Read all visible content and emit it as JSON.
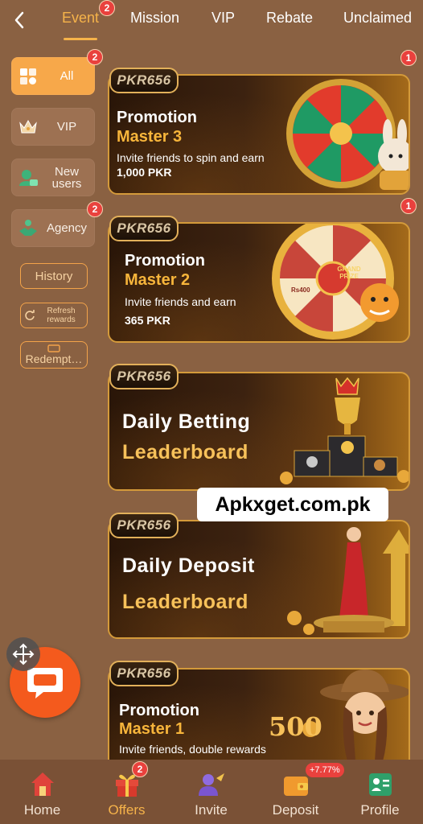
{
  "tabs": [
    {
      "label": "Event",
      "active": true,
      "badge": "2"
    },
    {
      "label": "Mission"
    },
    {
      "label": "VIP"
    },
    {
      "label": "Rebate"
    },
    {
      "label": "Unclaimed"
    }
  ],
  "sidebar": {
    "items": [
      {
        "label": "All",
        "icon": "grid-icon",
        "active": true,
        "badge": "2"
      },
      {
        "label": "VIP",
        "icon": "crown-icon"
      },
      {
        "label": "New users",
        "icon": "new-user-icon"
      },
      {
        "label": "Agency",
        "icon": "handshake-icon",
        "badge": "2"
      }
    ],
    "history_label": "History",
    "refresh_label": "Refresh rewards",
    "redeem_label": "Redempt…"
  },
  "banners": [
    {
      "logo": "PKR656",
      "title1": "Promotion",
      "title2": "Master 3",
      "desc": "Invite friends to spin and earn",
      "amount": "1,000 PKR",
      "badge": "1"
    },
    {
      "logo": "PKR656",
      "title1": "Promotion",
      "title2": "Master 2",
      "desc": "Invite friends and earn",
      "amount": "365 PKR",
      "badge": "1"
    },
    {
      "logo": "PKR656",
      "title1": "Daily Betting",
      "title2": "Leaderboard"
    },
    {
      "logo": "PKR656",
      "title1": "Daily Deposit",
      "title2": "Leaderboard"
    },
    {
      "logo": "PKR656",
      "title1": "Promotion",
      "title2": "Master 1",
      "desc": "Invite friends, double rewards",
      "big_number": "500"
    }
  ],
  "wheel_labels": {
    "grand_prize": "GRAND PRIZE",
    "rs": "Rs400"
  },
  "watermark": "Apkxget.com.pk",
  "bottom_nav": [
    {
      "label": "Home",
      "icon": "home-icon"
    },
    {
      "label": "Offers",
      "icon": "gift-icon",
      "active": true,
      "badge": "2"
    },
    {
      "label": "Invite",
      "icon": "invite-icon"
    },
    {
      "label": "Deposit",
      "icon": "wallet-icon",
      "badge": "+7.77%"
    },
    {
      "label": "Profile",
      "icon": "profile-icon"
    }
  ],
  "colors": {
    "background": "#8a6142",
    "accent": "#f6b34a",
    "badge": "#e9413d",
    "chat": "#f45a1d"
  }
}
